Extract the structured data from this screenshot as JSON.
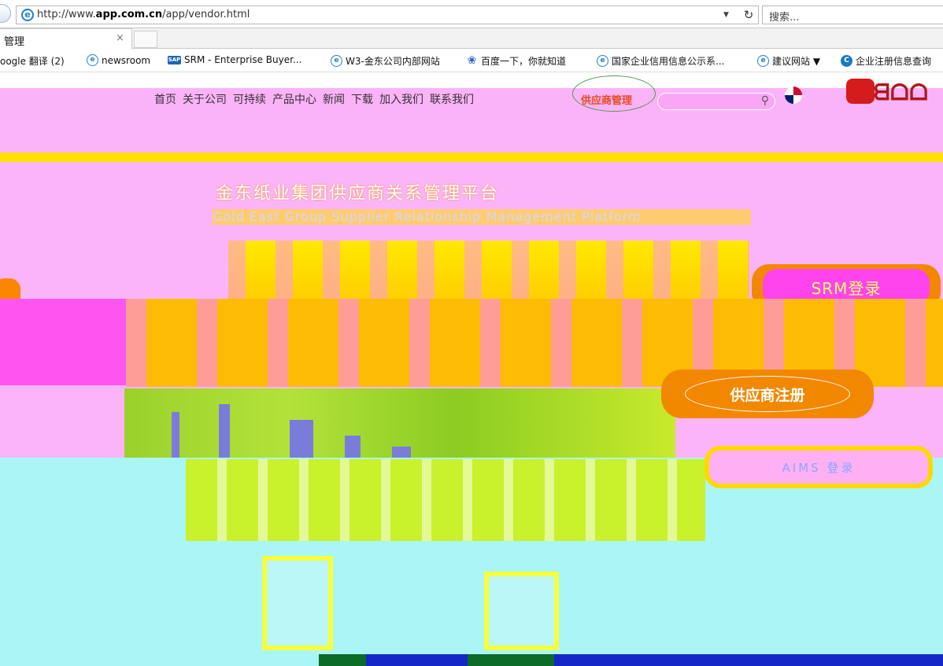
{
  "browser": {
    "url_prefix": "http://www.",
    "url_host": "app.com.cn",
    "url_path": "/app/vendor.html",
    "url_dropdown_icon": "chevron-down-icon",
    "refresh_icon": "refresh-icon",
    "search_placeholder": "搜索...",
    "tab_title": "管理",
    "tab_close": "×"
  },
  "favorites": [
    {
      "label": "oogle 翻译 (2)",
      "icon": "none"
    },
    {
      "label": "newsroom",
      "icon": "ie-page-icon"
    },
    {
      "label": "SRM - Enterprise Buyer...",
      "icon": "sap-icon"
    },
    {
      "label": "W3-金东公司内部网站",
      "icon": "ie-page-icon"
    },
    {
      "label": "百度一下，你就知道",
      "icon": "baidu-paw-icon"
    },
    {
      "label": "国家企业信用信息公示系...",
      "icon": "ie-page-icon"
    },
    {
      "label": "建议网站 ▼",
      "icon": "ie-page-icon"
    },
    {
      "label": "企业注册信息查询",
      "icon": "ec-icon"
    }
  ],
  "site": {
    "nav": [
      "首页",
      "关于公司",
      "可持续",
      "产品中心",
      "新闻",
      "下载",
      "加入我们",
      "联系我们"
    ],
    "vendor_management": "供应商管理",
    "search_icon": "search-icon",
    "flag_icon": "uk-flag-icon",
    "logo_text": "ᗺᗝᗝ",
    "platform_title_cn": "金东纸业集团供应商关系管理平台",
    "platform_title_en": "Gold East Group Supplier Relationship Management Platform",
    "buttons": {
      "srm_login": "SRM登录",
      "supplier_register": "供应商注册",
      "aims": "AIMS 登录"
    }
  },
  "colors": {
    "pink": "#fcb4f8",
    "gold": "#ffe000",
    "orange": "#f28800",
    "cyan": "#aaf6f6",
    "lime": "#c9f12c"
  }
}
